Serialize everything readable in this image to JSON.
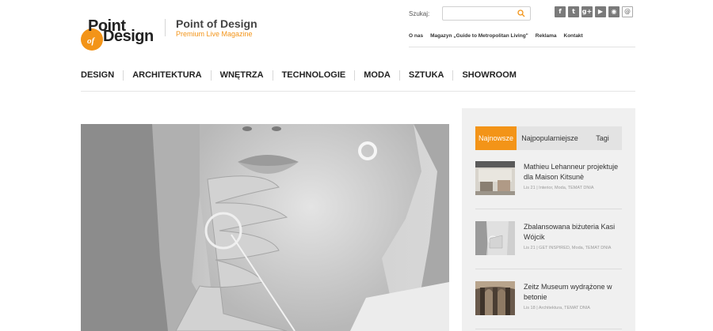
{
  "logo": {
    "word1": "Point",
    "word2": "of",
    "word3": "Design"
  },
  "brand": {
    "title": "Point of Design",
    "subtitle": "Premium Live Magazine"
  },
  "search": {
    "label": "Szukaj:",
    "placeholder": "",
    "icon": "search-icon"
  },
  "social": [
    {
      "name": "facebook",
      "glyph": "f"
    },
    {
      "name": "twitter",
      "glyph": "t"
    },
    {
      "name": "google-plus",
      "glyph": "g+"
    },
    {
      "name": "youtube",
      "glyph": "▶"
    },
    {
      "name": "rss",
      "glyph": "◉"
    },
    {
      "name": "email",
      "glyph": "@"
    }
  ],
  "top_links": [
    "O nas",
    "Magazyn „Guide to Metropolitan Living\"",
    "Reklama",
    "Kontakt"
  ],
  "nav": [
    "DESIGN",
    "ARCHITEKTURA",
    "WNĘTRZA",
    "TECHNOLOGIE",
    "MODA",
    "SZTUKA",
    "SHOWROOM"
  ],
  "hero": {
    "description": "Black and white close-up of a woman touching her lips, wearing a large ring and a circle earring"
  },
  "sidebar": {
    "tabs": [
      "Najnowsze",
      "Najpopularniejsze",
      "Tagi"
    ],
    "active_tab": "Najnowsze",
    "posts": [
      {
        "title": "Mathieu Lehanneur projektuje dla Maison Kitsunè",
        "meta": "Lis 21 | Interior, Moda, TEMAT DNIA"
      },
      {
        "title": "Zbalansowana biżuteria Kasi Wójcik",
        "meta": "Lis 21 | GET INSPIRED, Moda, TEMAT DNIA"
      },
      {
        "title": "Zeitz Museum wydrążone w betonie",
        "meta": "Lis 18 | Architektura, TEMAT DNIA"
      }
    ]
  },
  "colors": {
    "accent": "#f39418",
    "text": "#333333",
    "sidebar_bg": "#f0f0f0"
  }
}
